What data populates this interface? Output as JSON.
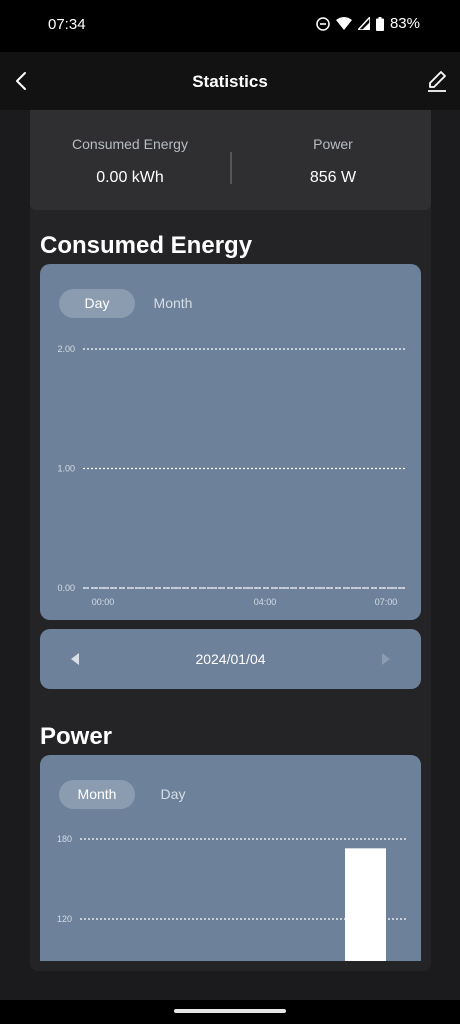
{
  "status_bar": {
    "time": "07:34",
    "battery": "83%",
    "icons": [
      "do-not-disturb-icon",
      "wifi-icon",
      "signal-icon",
      "battery-icon"
    ]
  },
  "nav": {
    "title": "Statistics",
    "back_icon": "back-chevron-icon",
    "edit_icon": "edit-pencil-icon"
  },
  "summary": {
    "energy_label": "Consumed Energy",
    "energy_value": "0.00 kWh",
    "power_label": "Power",
    "power_value": "856 W"
  },
  "energy_section": {
    "title": "Consumed Energy",
    "tabs": [
      {
        "label": "Day",
        "active": true
      },
      {
        "label": "Month",
        "active": false
      }
    ],
    "date": "2024/01/04"
  },
  "power_section": {
    "title": "Power",
    "tabs": [
      {
        "label": "Month",
        "active": true
      },
      {
        "label": "Day",
        "active": false
      }
    ]
  },
  "chart_data": [
    {
      "type": "line",
      "title": "Consumed Energy",
      "x_ticks": [
        "00:00",
        "04:00",
        "07:00"
      ],
      "y_ticks": [
        "2.00",
        "1.00",
        "0.00"
      ],
      "ylim": [
        0,
        2
      ],
      "series": [
        {
          "values": [
            0,
            0,
            0
          ]
        }
      ],
      "grid": true
    },
    {
      "type": "bar",
      "title": "Power",
      "y_ticks": [
        "180",
        "120"
      ],
      "ylim": [
        120,
        180
      ],
      "series": [
        {
          "values": [
            173
          ]
        }
      ],
      "grid": true
    }
  ],
  "colors": {
    "card": "#6d819a",
    "background": "#1b1b1d",
    "bar": "#ffffff"
  }
}
